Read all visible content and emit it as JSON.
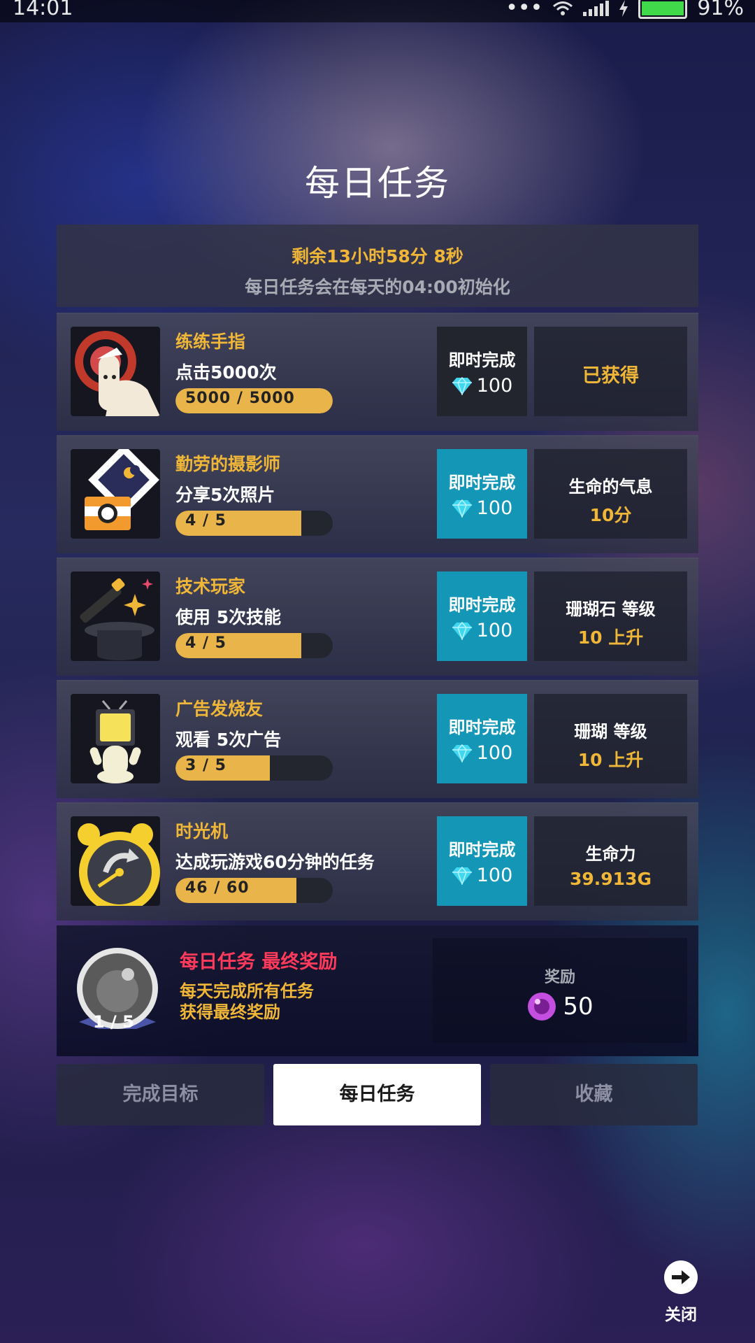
{
  "status_bar": {
    "time": "14:01",
    "dots": "•••",
    "battery": "91%"
  },
  "title": "每日任务",
  "timer": {
    "remaining": "剩余13小时58分 8秒",
    "reset_note": "每日任务会在每天的04:00初始化"
  },
  "tasks": [
    {
      "name": "练练手指",
      "desc": "点击5000次",
      "progress_text": "5000 / 5000",
      "progress": 1.0,
      "instant_label": "即时完成",
      "instant_cost": "100",
      "reward_label": "",
      "reward_value": "",
      "status": "已获得"
    },
    {
      "name": "勤劳的摄影师",
      "desc": "分享5次照片",
      "progress_text": "4 / 5",
      "progress": 0.8,
      "instant_label": "即时完成",
      "instant_cost": "100",
      "reward_label": "生命的气息",
      "reward_value": "10分",
      "status": ""
    },
    {
      "name": "技术玩家",
      "desc": "使用 5次技能",
      "progress_text": "4 / 5",
      "progress": 0.8,
      "instant_label": "即时完成",
      "instant_cost": "100",
      "reward_label": "珊瑚石 等级",
      "reward_value": "10 上升",
      "status": ""
    },
    {
      "name": "广告发烧友",
      "desc": "观看 5次广告",
      "progress_text": "3 / 5",
      "progress": 0.6,
      "instant_label": "即时完成",
      "instant_cost": "100",
      "reward_label": "珊瑚 等级",
      "reward_value": "10 上升",
      "status": ""
    },
    {
      "name": "时光机",
      "desc": "达成玩游戏60分钟的任务",
      "progress_text": "46 / 60",
      "progress": 0.7667,
      "instant_label": "即时完成",
      "instant_cost": "100",
      "reward_label": "生命力",
      "reward_value": "39.913G",
      "status": ""
    }
  ],
  "final_reward": {
    "title": "每日任务 最终奖励",
    "desc_line1": "每天完成所有任务",
    "desc_line2": "获得最终奖励",
    "progress_text": "1 / 5",
    "reward_label": "奖励",
    "reward_value": "50"
  },
  "tabs": [
    {
      "label": "完成目标",
      "active": false
    },
    {
      "label": "每日任务",
      "active": true
    },
    {
      "label": "收藏",
      "active": false
    }
  ],
  "close_label": "关闭",
  "colors": {
    "accent_gold": "#f0b638",
    "instant_blue": "#1497b7",
    "final_red": "#ff3a5a",
    "diamond": "#3fd8f0",
    "orb_purple": "#c34ee0"
  }
}
